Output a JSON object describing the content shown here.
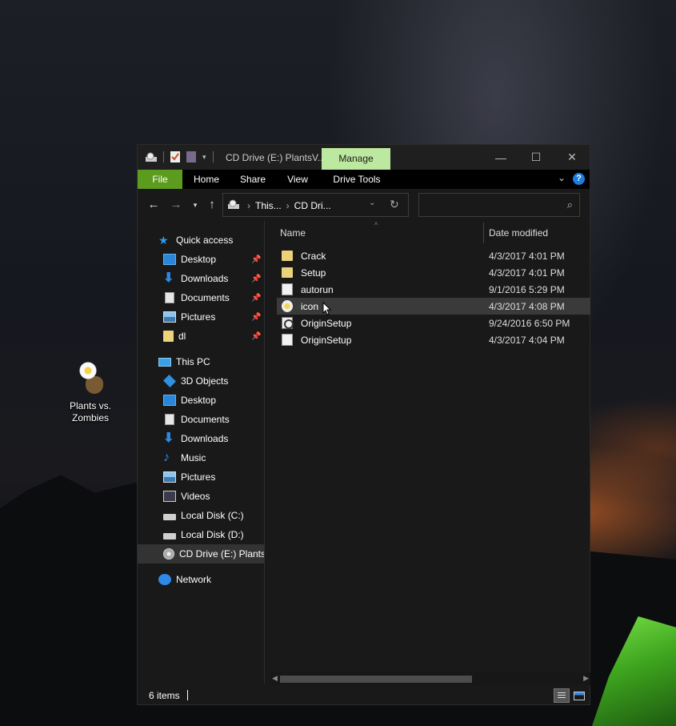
{
  "desktop": {
    "icon_label": "Plants vs. Zombies"
  },
  "window": {
    "title": "CD Drive (E:) PlantsV...",
    "context_tab": "Manage",
    "ribbon_tabs": [
      "File",
      "Home",
      "Share",
      "View",
      "Drive Tools"
    ],
    "address": {
      "crumbs": [
        "This...",
        "CD Dri..."
      ]
    },
    "search_placeholder": ""
  },
  "navigation": {
    "quick_access": {
      "label": "Quick access",
      "items": [
        {
          "label": "Desktop",
          "icon": "desktop-icon",
          "pinned": true
        },
        {
          "label": "Downloads",
          "icon": "downloads-icon",
          "pinned": true
        },
        {
          "label": "Documents",
          "icon": "documents-icon",
          "pinned": true
        },
        {
          "label": "Pictures",
          "icon": "pictures-icon",
          "pinned": true
        },
        {
          "label": "dl",
          "icon": "folder-icon",
          "pinned": true
        }
      ]
    },
    "this_pc": {
      "label": "This PC",
      "items": [
        {
          "label": "3D Objects",
          "icon": "3d-objects-icon"
        },
        {
          "label": "Desktop",
          "icon": "desktop-icon"
        },
        {
          "label": "Documents",
          "icon": "documents-icon"
        },
        {
          "label": "Downloads",
          "icon": "downloads-icon"
        },
        {
          "label": "Music",
          "icon": "music-icon"
        },
        {
          "label": "Pictures",
          "icon": "pictures-icon"
        },
        {
          "label": "Videos",
          "icon": "videos-icon"
        },
        {
          "label": "Local Disk (C:)",
          "icon": "drive-icon"
        },
        {
          "label": "Local Disk (D:)",
          "icon": "drive-icon"
        },
        {
          "label": "CD Drive (E:) PlantsVsZombies",
          "icon": "cd-drive-icon",
          "selected": true
        }
      ]
    },
    "network": {
      "label": "Network"
    }
  },
  "file_list": {
    "columns": [
      "Name",
      "Date modified"
    ],
    "rows": [
      {
        "name": "Crack",
        "date": "4/3/2017 4:01 PM",
        "icon": "folder-icon"
      },
      {
        "name": "Setup",
        "date": "4/3/2017 4:01 PM",
        "icon": "folder-icon"
      },
      {
        "name": "autorun",
        "date": "9/1/2016 5:29 PM",
        "icon": "settings-file-icon"
      },
      {
        "name": "icon",
        "date": "4/3/2017 4:08 PM",
        "icon": "flower-icon",
        "hovered": true
      },
      {
        "name": "OriginSetup",
        "date": "9/24/2016 6:50 PM",
        "icon": "origin-icon"
      },
      {
        "name": "OriginSetup",
        "date": "4/3/2017 4:04 PM",
        "icon": "settings-file-icon"
      }
    ]
  },
  "status": {
    "item_count": "6 items"
  },
  "colors": {
    "file_tab": "#5b9b1d",
    "manage_tab": "#bde8a0",
    "accent_blue": "#2e8ae6"
  }
}
